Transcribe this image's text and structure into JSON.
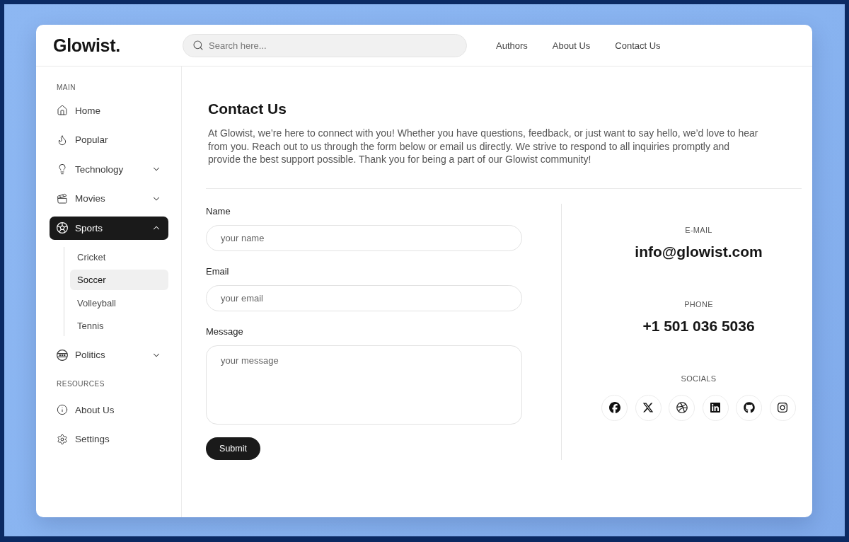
{
  "logo": "Glowist.",
  "search": {
    "placeholder": "Search here..."
  },
  "nav": [
    "Authors",
    "About Us",
    "Contact Us"
  ],
  "sidebar": {
    "sections": [
      {
        "title": "MAIN",
        "items": [
          {
            "kind": "link",
            "label": "Home",
            "selected": false
          },
          {
            "kind": "link",
            "label": "Popular",
            "selected": false
          },
          {
            "kind": "group",
            "label": "Technology",
            "selected": false,
            "expanded": false
          },
          {
            "kind": "group",
            "label": "Movies",
            "selected": false,
            "expanded": false
          },
          {
            "kind": "group",
            "label": "Sports",
            "selected": true,
            "expanded": true,
            "children": [
              {
                "label": "Cricket",
                "selected": false
              },
              {
                "label": "Soccer",
                "selected": true
              },
              {
                "label": "Volleyball",
                "selected": false
              },
              {
                "label": "Tennis",
                "selected": false
              }
            ]
          },
          {
            "kind": "group",
            "label": "Politics",
            "selected": false,
            "expanded": false
          }
        ]
      },
      {
        "title": "RESOURCES",
        "items": [
          {
            "kind": "link",
            "label": "About Us",
            "selected": false
          },
          {
            "kind": "link",
            "label": "Settings",
            "selected": false
          }
        ]
      }
    ]
  },
  "page": {
    "title": "Contact Us",
    "intro": "At Glowist, we’re here to connect with you! Whether you have questions, feedback, or just want to say hello, we’d love to hear from you. Reach out to us through the form below or email us directly. We strive to respond to all inquiries promptly and provide the best support possible. Thank you for being a part of our Glowist community!"
  },
  "form": {
    "fields": [
      {
        "kind": "input",
        "label": "Name",
        "placeholder": "your name"
      },
      {
        "kind": "input",
        "label": "Email",
        "placeholder": "your email"
      },
      {
        "kind": "textarea",
        "label": "Message",
        "placeholder": "your message"
      }
    ],
    "submit": "Submit"
  },
  "contact": {
    "details": [
      {
        "label": "E-MAIL",
        "value": "info@glowist.com"
      },
      {
        "label": "PHONE",
        "value": "+1 501 036 5036"
      }
    ],
    "socials_label": "SOCIALS"
  }
}
